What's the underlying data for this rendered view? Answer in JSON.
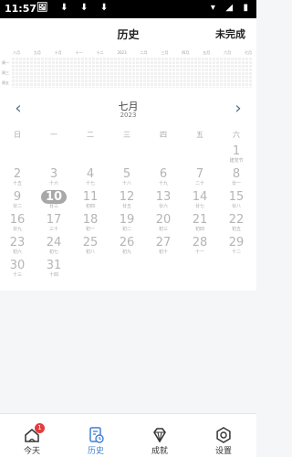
{
  "status_bar": {
    "time": "11:57",
    "left_icons": "🖼 ⬇ ⬇ ⬇",
    "right_icons": "▾ ◢ ▮"
  },
  "header": {
    "title": "历史",
    "right_action": "未完成"
  },
  "heatmap": {
    "months": [
      "八月",
      "九月",
      "十月",
      "十一",
      "十二",
      "2023",
      "二月",
      "三月",
      "四月",
      "五月",
      "六月",
      "七月"
    ],
    "row_labels": [
      "周一",
      "周三",
      "周五"
    ]
  },
  "calendar": {
    "month": "七月",
    "year": "2023",
    "weekdays": [
      "日",
      "一",
      "二",
      "三",
      "四",
      "五",
      "六"
    ],
    "days": [
      {
        "n": "1",
        "l": "建党节"
      },
      {
        "n": "2",
        "l": "十五"
      },
      {
        "n": "3",
        "l": "十六"
      },
      {
        "n": "4",
        "l": "十七"
      },
      {
        "n": "5",
        "l": "十八"
      },
      {
        "n": "6",
        "l": "十九"
      },
      {
        "n": "7",
        "l": "二十"
      },
      {
        "n": "8",
        "l": "廿一"
      },
      {
        "n": "9",
        "l": "廿二"
      },
      {
        "n": "10",
        "l": "廿三"
      },
      {
        "n": "11",
        "l": "初四"
      },
      {
        "n": "12",
        "l": "廿五"
      },
      {
        "n": "13",
        "l": "廿六"
      },
      {
        "n": "14",
        "l": "廿七"
      },
      {
        "n": "15",
        "l": "廿八"
      },
      {
        "n": "16",
        "l": "廿九"
      },
      {
        "n": "17",
        "l": "三十"
      },
      {
        "n": "18",
        "l": "初一"
      },
      {
        "n": "19",
        "l": "初二"
      },
      {
        "n": "20",
        "l": "初三"
      },
      {
        "n": "21",
        "l": "初四"
      },
      {
        "n": "22",
        "l": "初五"
      },
      {
        "n": "23",
        "l": "初六"
      },
      {
        "n": "24",
        "l": "初七"
      },
      {
        "n": "25",
        "l": "初八"
      },
      {
        "n": "26",
        "l": "初九"
      },
      {
        "n": "27",
        "l": "初十"
      },
      {
        "n": "28",
        "l": "十一"
      },
      {
        "n": "29",
        "l": "十二"
      },
      {
        "n": "30",
        "l": "十三"
      },
      {
        "n": "31",
        "l": "十四"
      }
    ],
    "selected_day": "10",
    "first_weekday_index": 6
  },
  "tabbar": {
    "tabs": [
      {
        "label": "今天",
        "icon": "home-icon"
      },
      {
        "label": "历史",
        "icon": "history-icon"
      },
      {
        "label": "成就",
        "icon": "diamond-icon"
      },
      {
        "label": "设置",
        "icon": "gear-icon"
      }
    ],
    "badge_count": "1",
    "active_color": "#3f7fd6"
  }
}
